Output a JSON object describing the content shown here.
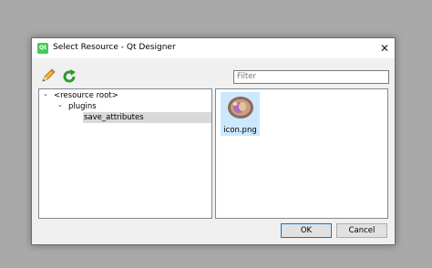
{
  "window": {
    "title": "Select Resource - Qt Designer",
    "app_icon_text": "Qt",
    "close_glyph": "✕"
  },
  "toolbar": {
    "edit_icon": "pencil-icon",
    "reload_icon": "reload-icon"
  },
  "filter": {
    "placeholder": "Filter",
    "value": ""
  },
  "tree": {
    "items": [
      {
        "label": "<resource root>",
        "expanded": true
      },
      {
        "label": "plugins",
        "expanded": true
      },
      {
        "label": "save_attributes",
        "selected": true
      }
    ]
  },
  "files": [
    {
      "label": "icon.png",
      "selected": true
    }
  ],
  "buttons": {
    "ok": "OK",
    "cancel": "Cancel"
  },
  "colors": {
    "selection_tree": "#d9d9d9",
    "selection_file": "#cce8ff",
    "qt_green": "#41cd52",
    "default_button_border": "#0078d7"
  }
}
